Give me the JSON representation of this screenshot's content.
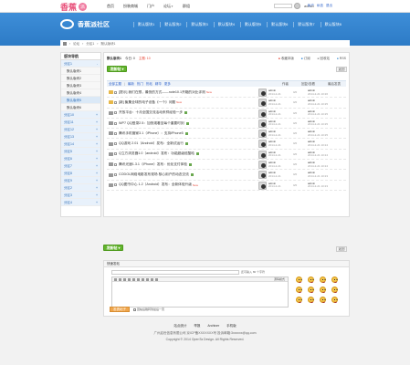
{
  "top": {
    "logo_text": "香蕉",
    "logo_badge": "派",
    "nav": [
      "首页",
      "扮装商城",
      "门户",
      "论坛",
      "群组"
    ],
    "user_name": "admin",
    "links": [
      "帐户",
      "私信",
      "退出"
    ]
  },
  "banner": {
    "title": "香蕉派社区",
    "boards": [
      "默认版块1",
      "默认版块2",
      "默认版块3",
      "默认版块4",
      "默认版块5",
      "默认版块6",
      "默认版块7",
      "默认版块8"
    ]
  },
  "crumb": [
    "论坛",
    "分区1",
    "默认版块1"
  ],
  "sidebar": {
    "title": "版块导航",
    "items": [
      {
        "label": "分区1",
        "mark": "-",
        "kind": "group"
      },
      {
        "label": "默认版块1",
        "mark": "",
        "kind": "sub"
      },
      {
        "label": "默认版块2",
        "mark": "",
        "kind": "sub"
      },
      {
        "label": "默认版块3",
        "mark": "",
        "kind": "sub"
      },
      {
        "label": "默认版块4",
        "mark": "",
        "kind": "sub"
      },
      {
        "label": "默认版块5",
        "mark": "",
        "kind": "active"
      },
      {
        "label": "默认版块6",
        "mark": "",
        "kind": "sub"
      },
      {
        "label": "分区10",
        "mark": "+",
        "kind": "group"
      },
      {
        "label": "分区11",
        "mark": "+",
        "kind": "group"
      },
      {
        "label": "分区12",
        "mark": "+",
        "kind": "group"
      },
      {
        "label": "分区13",
        "mark": "+",
        "kind": "group"
      },
      {
        "label": "分区14",
        "mark": "+",
        "kind": "group"
      },
      {
        "label": "分区5",
        "mark": "+",
        "kind": "group"
      },
      {
        "label": "分区6",
        "mark": "+",
        "kind": "group"
      },
      {
        "label": "分区7",
        "mark": "+",
        "kind": "group"
      },
      {
        "label": "分区8",
        "mark": "+",
        "kind": "group"
      },
      {
        "label": "分区9",
        "mark": "+",
        "kind": "group"
      },
      {
        "label": "分区2",
        "mark": "+",
        "kind": "group"
      },
      {
        "label": "分区3",
        "mark": "+",
        "kind": "group"
      },
      {
        "label": "分区4",
        "mark": "+",
        "kind": "group"
      }
    ]
  },
  "forum": {
    "name": "默认版块1",
    "today_label": "今日: 0",
    "topics_label": "主题: 10",
    "actions": [
      "收藏本版",
      "订阅",
      "回收站",
      "RSS"
    ],
    "post_label": "发新帖",
    "back_label": "返回",
    "filters": [
      "全部主题",
      "最新",
      "热门",
      "热帖",
      "精华",
      "更多"
    ],
    "col_author": "作者",
    "col_count": "回复/查看",
    "col_last": "最后发表"
  },
  "threads": [
    {
      "title": "[提示] 我们在想，最快的方式——note10.1开箱的对比评测",
      "tag": "New",
      "author": "admin",
      "date": "2014-2-21",
      "count": "0/0",
      "last_user": "admin",
      "last_date": "2014-2-21 10:26",
      "folder": "gold"
    },
    {
      "title": "[新] 聚集全球的电子设备《一个》问题",
      "tag": "New",
      "author": "admin",
      "date": "2014-2-21",
      "count": "0/0",
      "last_user": "admin",
      "last_date": "2014-2-21 10:25",
      "folder": "gold"
    },
    {
      "title": "开放平台：十月全国交流活动来样经验一步",
      "tag": "",
      "author": "admin",
      "date": "2014-2-21",
      "count": "0/0",
      "last_user": "admin",
      "last_date": "2014-2-21 10:25",
      "folder": "gray"
    },
    {
      "title": "WP7 QQ登录2.5：加快观看至每个重要时刻",
      "tag": "",
      "author": "admin",
      "date": "2014-2-21",
      "count": "0/0",
      "last_user": "admin",
      "last_date": "2014-2-21 10:25",
      "folder": "gray"
    },
    {
      "title": "腾讯手机管家3.1（iPhone）：支持iPhone5",
      "tag": "",
      "author": "admin",
      "date": "2014-2-21",
      "count": "0/0",
      "last_user": "admin",
      "last_date": "2014-2-21 10:25",
      "folder": "gray"
    },
    {
      "title": "QQ游戏 2.01（Android）发布：全新试运行",
      "tag": "",
      "author": "admin",
      "date": "2014-2-21",
      "count": "0/0",
      "last_user": "admin",
      "last_date": "2014-2-21 10:24",
      "folder": "gray"
    },
    {
      "title": "Q立方浏览器1.0（android）发布：功能超级炫酷哈",
      "tag": "",
      "author": "admin",
      "date": "2014-2-21",
      "count": "0/0",
      "last_user": "admin",
      "last_date": "2014-2-21 10:24",
      "folder": "gray"
    },
    {
      "title": "腾讯光速1.3.1（iPhone）发布：优化支付体验",
      "tag": "",
      "author": "admin",
      "date": "2014-2-21",
      "count": "0/0",
      "last_user": "admin",
      "last_date": "2014-2-21 10:24",
      "folder": "gray"
    },
    {
      "title": "CODOL网络电影发布现场 核心用户的动态交流",
      "tag": "",
      "author": "admin",
      "date": "2014-2-21",
      "count": "0/0",
      "last_user": "admin",
      "last_date": "2014-2-21 10:23",
      "folder": "gray"
    },
    {
      "title": "QQ图书中心 1.2（Android）发布：全新体验升级",
      "tag": "New",
      "author": "admin",
      "date": "2014-2-21",
      "count": "0/0",
      "last_user": "admin",
      "last_date": "2014-2-21 10:23",
      "folder": "gray"
    }
  ],
  "reply": {
    "title": "快速发帖",
    "hint": "还可输入 80 个字符",
    "source_label": "源码模式",
    "submit_label": "发表帖子",
    "option_label": "回帖后跳转到最后一页"
  },
  "footer": {
    "links": [
      "站点统计",
      "举报",
      "Archiver",
      "手机版"
    ],
    "icp": "广州启世信息有限公司 京ICP备XXXXXXX号 投诉邮箱:3xxxxxx@qq.com",
    "copyright": "Copyright © 2014 OpenTa Design. All Rights Reserved."
  }
}
